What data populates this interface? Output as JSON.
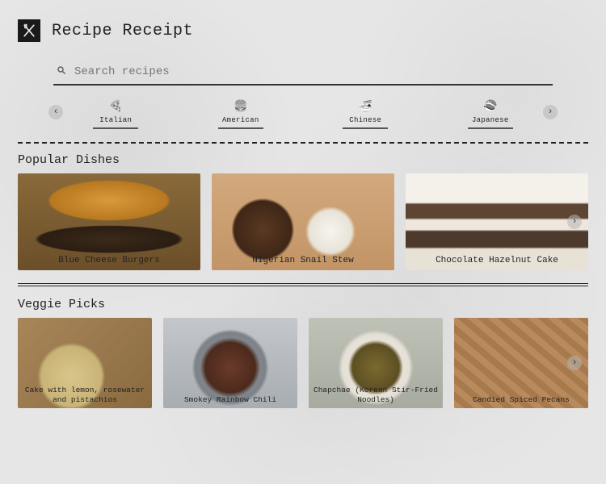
{
  "header": {
    "title": "Recipe Receipt"
  },
  "search": {
    "placeholder": "Search recipes"
  },
  "categories": {
    "items": [
      {
        "label": "Italian",
        "icon": "🍕"
      },
      {
        "label": "American",
        "icon": "🍔"
      },
      {
        "label": "Chinese",
        "icon": "🍜"
      },
      {
        "label": "Japanese",
        "icon": "🍣"
      }
    ]
  },
  "sections": {
    "popular": {
      "title": "Popular Dishes",
      "cards": [
        {
          "title": "Blue Cheese Burgers"
        },
        {
          "title": "Nigerian Snail Stew"
        },
        {
          "title": "Chocolate Hazelnut Cake"
        }
      ]
    },
    "veggie": {
      "title": "Veggie Picks",
      "cards": [
        {
          "title": "Cake with lemon, rosewater and pistachios"
        },
        {
          "title": "Smokey Rainbow Chili"
        },
        {
          "title": "Chapchae (Korean Stir-Fried Noodles)"
        },
        {
          "title": "Candied Spiced Pecans"
        }
      ]
    }
  }
}
